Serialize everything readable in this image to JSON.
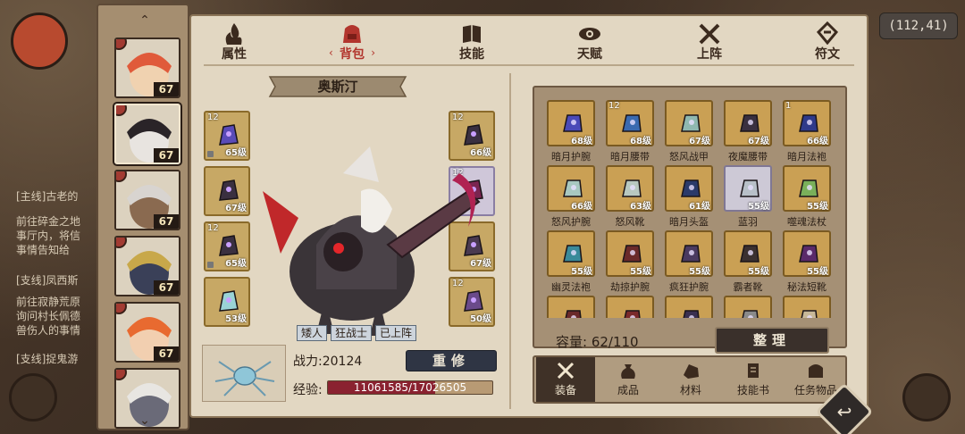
{
  "background": {
    "coord_text": "(112,41)",
    "quests": [
      "[主线]古老的",
      "前往碎金之地",
      "事厅内，将信",
      "事情告知给",
      "[支线]凤西斯",
      "前往寂静荒原",
      "询问村长佩德",
      "兽伤人的事情",
      "[支线]捉鬼游"
    ]
  },
  "characters": [
    {
      "level": "67",
      "palette": "red-hair",
      "selected": false
    },
    {
      "level": "67",
      "palette": "dark-armor",
      "selected": true
    },
    {
      "level": "67",
      "palette": "white-beast",
      "selected": false
    },
    {
      "level": "67",
      "palette": "gold-mask",
      "selected": false
    },
    {
      "level": "67",
      "palette": "orange-hair",
      "selected": false
    },
    {
      "level": "",
      "palette": "white-hair",
      "selected": false
    }
  ],
  "tabs": [
    {
      "label": "属性",
      "icon": "flame-icon",
      "active": false
    },
    {
      "label": "背包",
      "icon": "backpack-icon",
      "active": true
    },
    {
      "label": "技能",
      "icon": "book-icon",
      "active": false
    },
    {
      "label": "天赋",
      "icon": "eye-icon",
      "active": false
    },
    {
      "label": "上阵",
      "icon": "crossed-swords-icon",
      "active": false
    },
    {
      "label": "符文",
      "icon": "rune-icon",
      "active": false
    }
  ],
  "hero": {
    "name": "奥斯汀",
    "tags": [
      "矮人",
      "狂战士",
      "已上阵"
    ],
    "power_text": "战力:20124",
    "repair_label": "重修",
    "exp_label": "经验:",
    "exp_text": "11061585/17026505",
    "exp_progress": 0.65
  },
  "equip_slots": [
    {
      "plus": "12",
      "level": "65级",
      "color": "#5a4bb8",
      "rare": false,
      "lock": true
    },
    {
      "plus": "",
      "level": "67级",
      "color": "#3a3040",
      "rare": false,
      "lock": false
    },
    {
      "plus": "12",
      "level": "65级",
      "color": "#3a3040",
      "rare": false,
      "lock": true
    },
    {
      "plus": "",
      "level": "53级",
      "color": "#9ad3d6",
      "rare": false,
      "lock": false
    },
    {
      "plus": "12",
      "level": "66级",
      "color": "#3a3040",
      "rare": false,
      "lock": false
    },
    {
      "plus": "12",
      "level": "",
      "color": "#7a2550",
      "rare": true,
      "lock": false
    },
    {
      "plus": "",
      "level": "67级",
      "color": "#4a3a50",
      "rare": false,
      "lock": false
    },
    {
      "plus": "12",
      "level": "50级",
      "color": "#6a4a8a",
      "rare": false,
      "lock": false
    }
  ],
  "inventory": {
    "items": [
      {
        "name": "暗月护腕",
        "level": "68级",
        "plus": "",
        "color": "#4a4ab8",
        "rare": false
      },
      {
        "name": "暗月腰带",
        "level": "68级",
        "plus": "12",
        "color": "#3a6ab0",
        "rare": false
      },
      {
        "name": "怒风战甲",
        "level": "67级",
        "plus": "",
        "color": "#8fb8b0",
        "rare": false
      },
      {
        "name": "夜魔腰带",
        "level": "67级",
        "plus": "",
        "color": "#3a3040",
        "rare": false
      },
      {
        "name": "暗月法袍",
        "level": "66级",
        "plus": "1",
        "color": "#2f3a8a",
        "rare": false
      },
      {
        "name": "怒风护腕",
        "level": "66级",
        "plus": "",
        "color": "#a8c8c0",
        "rare": false
      },
      {
        "name": "怒风靴",
        "level": "63级",
        "plus": "",
        "color": "#b8c8c0",
        "rare": false
      },
      {
        "name": "暗月头盔",
        "level": "61级",
        "plus": "",
        "color": "#2a3a6a",
        "rare": false
      },
      {
        "name": "蓝羽",
        "level": "55级",
        "plus": "",
        "color": "#b8c0c8",
        "rare": true
      },
      {
        "name": "噬魂法杖",
        "level": "55级",
        "plus": "",
        "color": "#7ab05a",
        "rare": false
      },
      {
        "name": "幽灵法袍",
        "level": "55级",
        "plus": "",
        "color": "#3a8a9a",
        "rare": false
      },
      {
        "name": "劫掠护腕",
        "level": "55级",
        "plus": "",
        "color": "#6a2a2a",
        "rare": false
      },
      {
        "name": "疯狂护腕",
        "level": "55级",
        "plus": "",
        "color": "#4a3a60",
        "rare": false
      },
      {
        "name": "霸者靴",
        "level": "55级",
        "plus": "",
        "color": "#3a3030",
        "rare": false
      },
      {
        "name": "秘法短靴",
        "level": "55级",
        "plus": "",
        "color": "#5a2a6a",
        "rare": false
      },
      {
        "name": "",
        "level": "",
        "plus": "",
        "color": "#6a2a2a",
        "rare": false
      },
      {
        "name": "",
        "level": "",
        "plus": "",
        "color": "#7a2a2a",
        "rare": false
      },
      {
        "name": "",
        "level": "",
        "plus": "",
        "color": "#3a3050",
        "rare": false
      },
      {
        "name": "",
        "level": "",
        "plus": "",
        "color": "#8a8a8a",
        "rare": false
      },
      {
        "name": "",
        "level": "",
        "plus": "",
        "color": "#c8b898",
        "rare": false
      }
    ],
    "capacity_text": "容量:  62/110",
    "sort_label": "整理",
    "bag_tabs": [
      {
        "label": "装备",
        "icon": "crossed-tools-icon",
        "active": true
      },
      {
        "label": "成品",
        "icon": "sack-icon",
        "active": false
      },
      {
        "label": "材料",
        "icon": "ore-icon",
        "active": false
      },
      {
        "label": "技能书",
        "icon": "scroll-icon",
        "active": false
      },
      {
        "label": "任务物品",
        "icon": "chest-icon",
        "active": false
      }
    ]
  },
  "colors": {
    "panel": "#e2d7c2",
    "accent_red": "#b2352d",
    "gold_slot": "#c7a865",
    "rare_slot": "#cfc7d9",
    "button_dark": "#2f3544"
  }
}
